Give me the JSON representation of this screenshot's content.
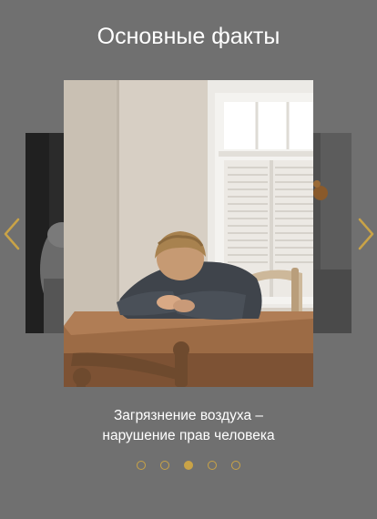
{
  "page": {
    "title": "Основные факты"
  },
  "carousel": {
    "caption_line1": "Загрязнение воздуха –",
    "caption_line2": "нарушение прав человека",
    "slide_count": 5,
    "active_index": 2,
    "main_image": "man-resting-head-on-table-photo",
    "prev_icon": "chevron-left-icon",
    "next_icon": "chevron-right-icon"
  },
  "colors": {
    "background": "#707070",
    "accent": "#c9a347",
    "text": "#ffffff"
  }
}
